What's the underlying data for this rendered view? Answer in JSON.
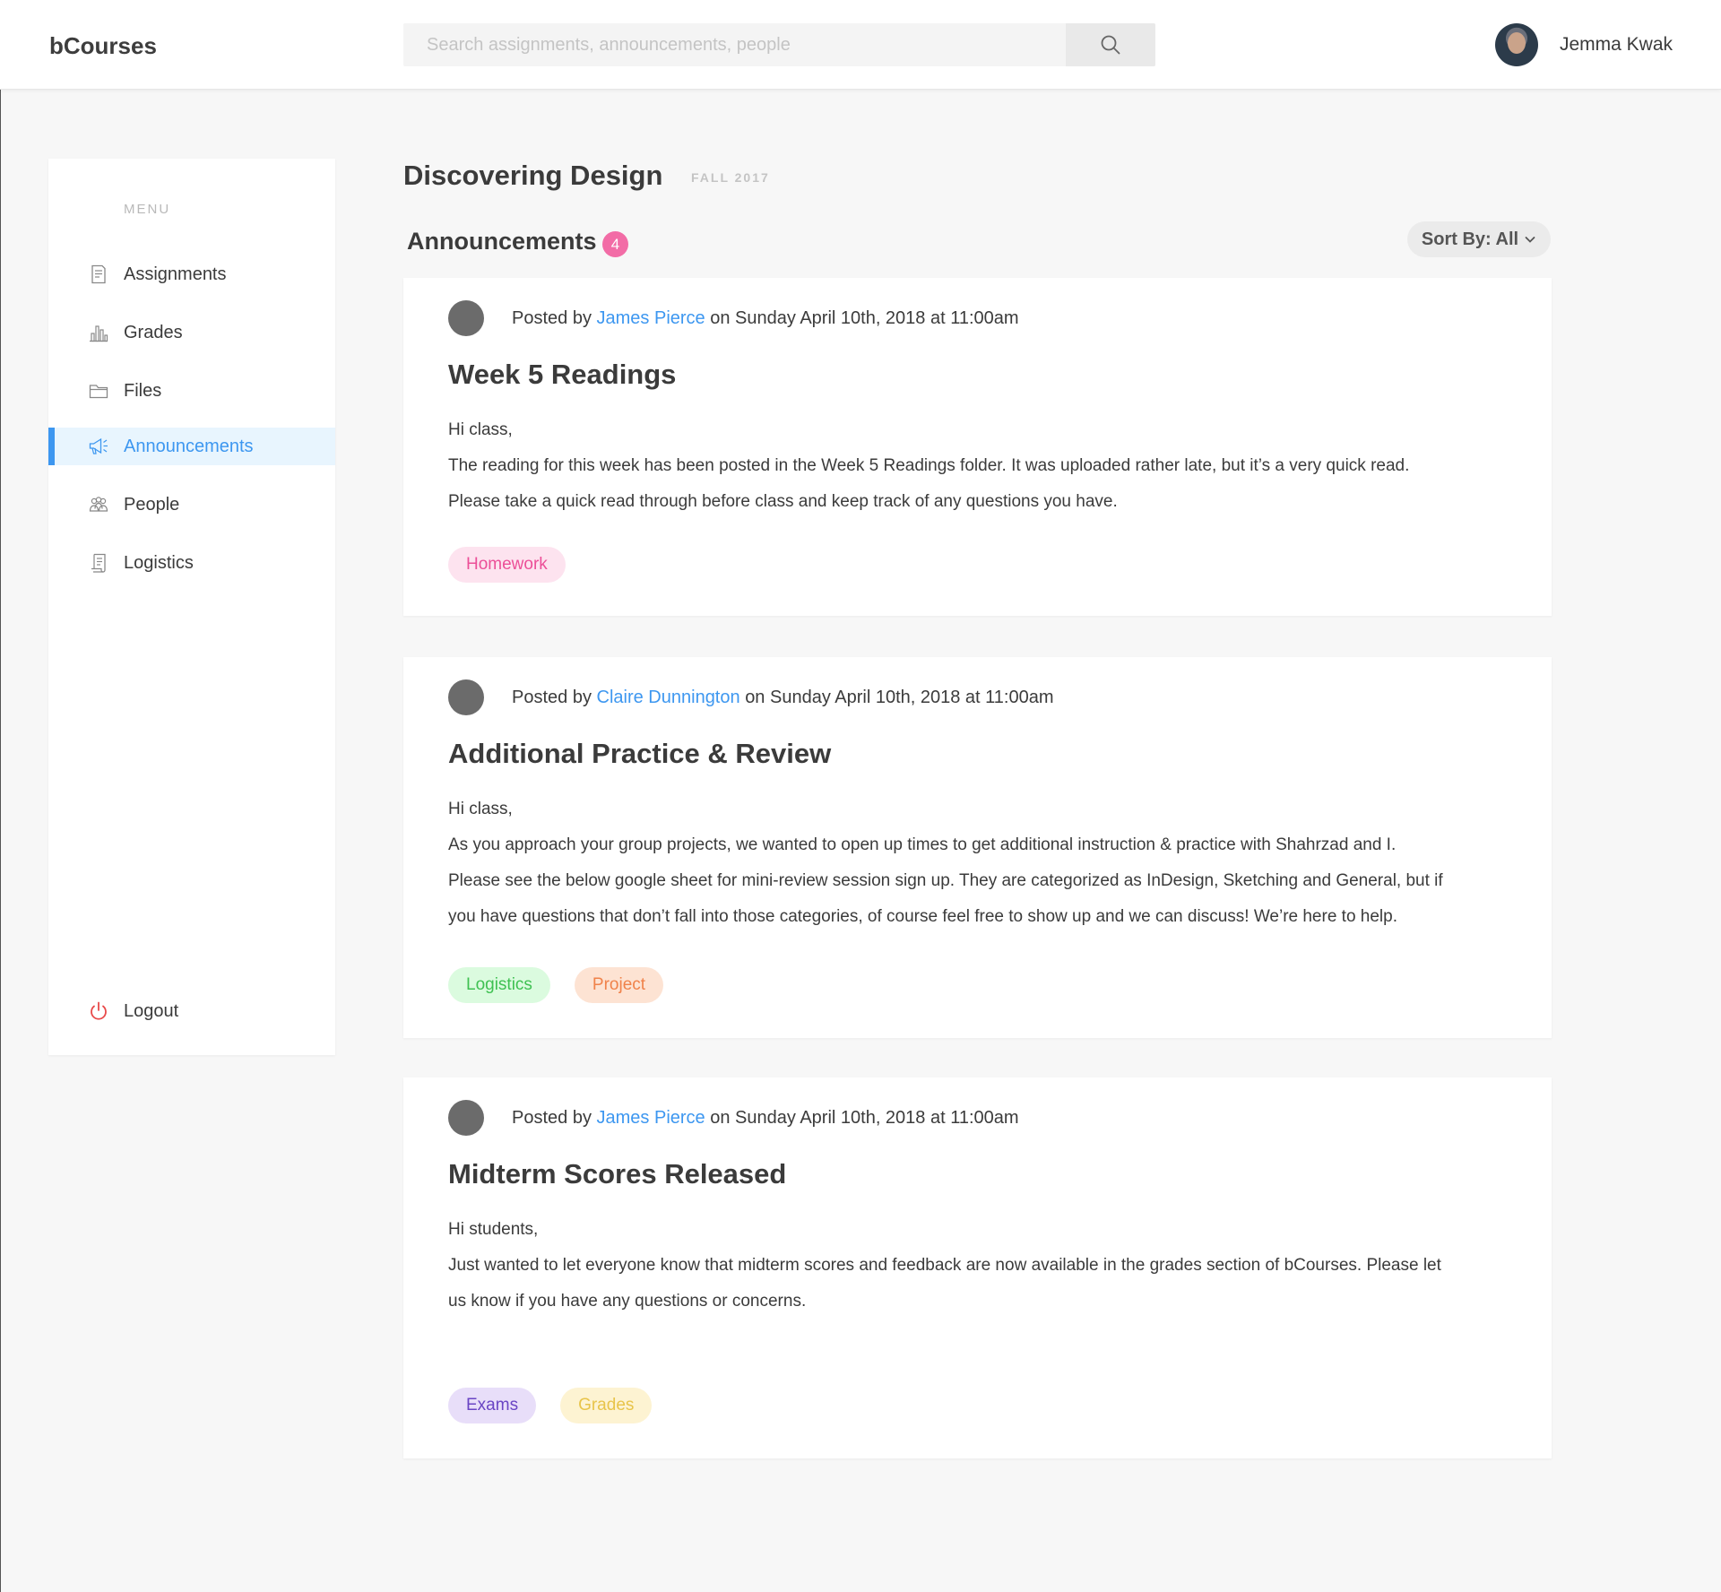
{
  "header": {
    "logo": "bCourses",
    "search_placeholder": "Search assignments, announcements, people",
    "user_name": "Jemma Kwak"
  },
  "sidebar": {
    "menu_title": "MENU",
    "items": [
      {
        "label": "Assignments",
        "icon": "assignment-icon"
      },
      {
        "label": "Grades",
        "icon": "bar-chart-icon"
      },
      {
        "label": "Files",
        "icon": "folder-icon"
      },
      {
        "label": "Announcements",
        "icon": "megaphone-icon",
        "active": true
      },
      {
        "label": "People",
        "icon": "people-icon"
      },
      {
        "label": "Logistics",
        "icon": "document-icon"
      }
    ],
    "logout_label": "Logout"
  },
  "main": {
    "course_title": "Discovering Design",
    "term": "FALL 2017",
    "section_title": "Announcements",
    "count": "4",
    "sort_label": "Sort By: All"
  },
  "announcements": [
    {
      "prefix": "Posted by",
      "author": "James Pierce",
      "date": "on Sunday April 10th, 2018 at 11:00am",
      "title": "Week 5 Readings",
      "lines": [
        "Hi class,",
        "The reading for this week has been posted in the Week 5 Readings folder. It was uploaded rather late, but it’s a very quick read.",
        "Please take a quick read through before class and keep track of any questions you have."
      ],
      "tags": [
        {
          "label": "Homework",
          "bg": "#fde3ef",
          "fg": "#ec4f98"
        }
      ]
    },
    {
      "prefix": "Posted by",
      "author": "Claire Dunnington",
      "date": "on Sunday April 10th, 2018 at 11:00am",
      "title": "Additional Practice & Review",
      "lines": [
        "Hi class,",
        "As you approach your group projects, we wanted to open up times to get additional instruction & practice with Shahrzad and I.",
        "Please see the below google sheet for mini-review session sign up. They are categorized as InDesign, Sketching and General, but if",
        "you have questions that don’t fall into those categories, of course feel free to show up and we can discuss! We’re here to help."
      ],
      "tags": [
        {
          "label": "Logistics",
          "bg": "#dbfbdf",
          "fg": "#3fc152"
        },
        {
          "label": "Project",
          "bg": "#fde3d3",
          "fg": "#f0824a"
        }
      ]
    },
    {
      "prefix": "Posted by",
      "author": "James Pierce",
      "date": "on Sunday April 10th, 2018 at 11:00am",
      "title": "Midterm Scores Released",
      "lines": [
        "Hi students,",
        "Just wanted to let everyone know that midterm scores and feedback are now available in the grades section of bCourses. Please let",
        "us know if you have any questions or concerns."
      ],
      "tags": [
        {
          "label": "Exams",
          "bg": "#e8def9",
          "fg": "#6a45c4"
        },
        {
          "label": "Grades",
          "bg": "#fdf3d2",
          "fg": "#e8c44a"
        }
      ]
    }
  ],
  "colors": {
    "accent": "#3d97f0",
    "badge": "#f26ca6",
    "logout_icon": "#e84a4a"
  }
}
